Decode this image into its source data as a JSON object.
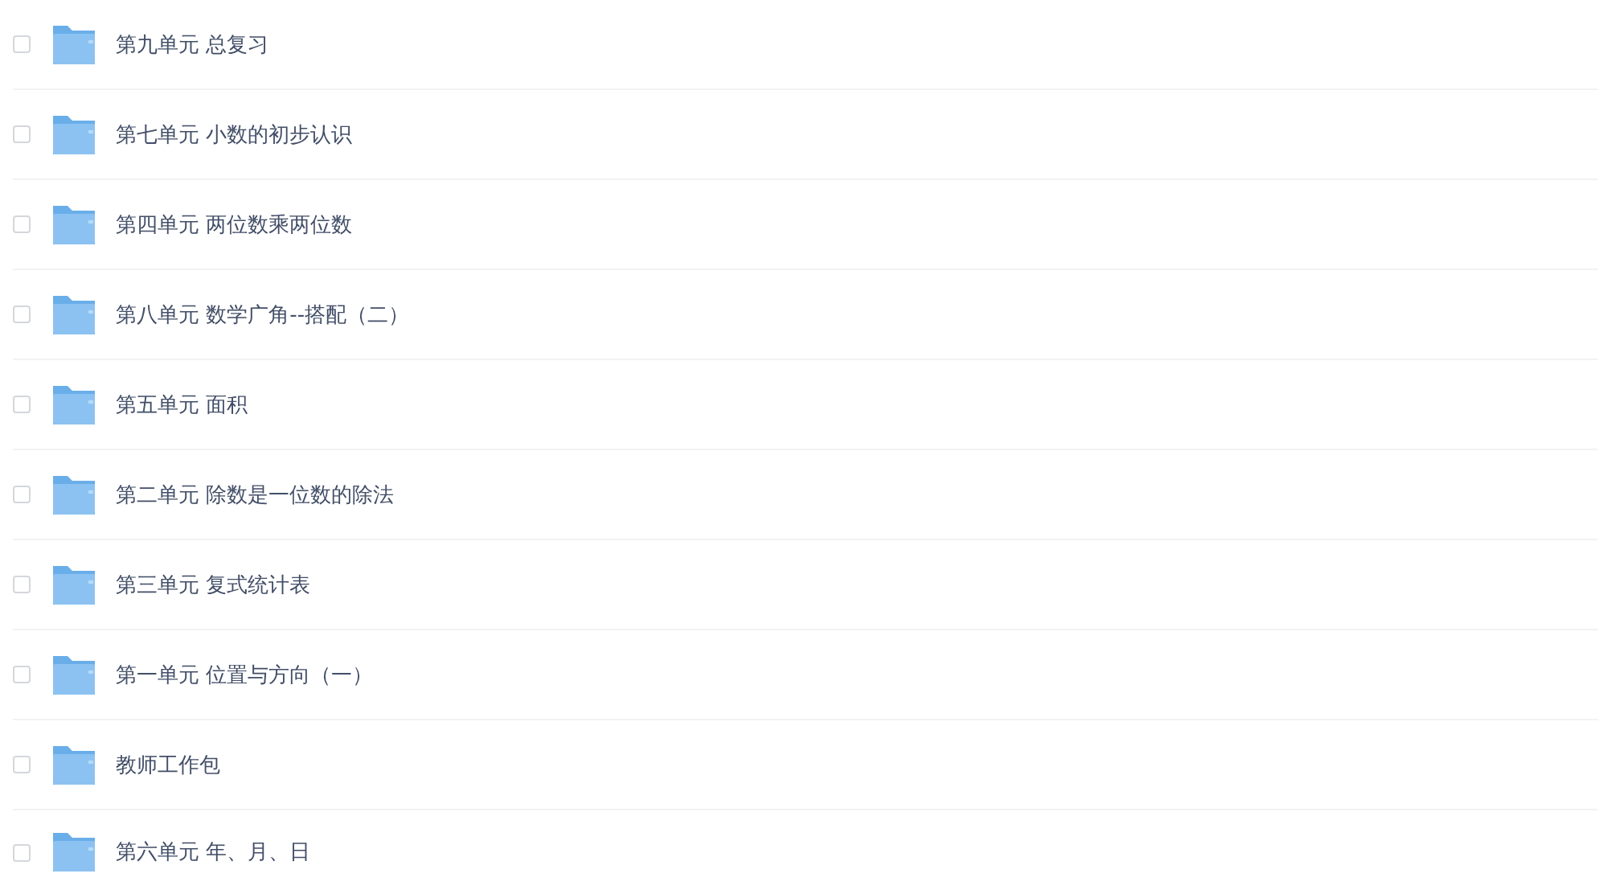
{
  "files": [
    {
      "name": "第九单元 总复习",
      "checked": false
    },
    {
      "name": "第七单元 小数的初步认识",
      "checked": false
    },
    {
      "name": "第四单元 两位数乘两位数",
      "checked": false
    },
    {
      "name": "第八单元 数学广角--搭配（二）",
      "checked": false
    },
    {
      "name": "第五单元 面积",
      "checked": false
    },
    {
      "name": "第二单元 除数是一位数的除法",
      "checked": false
    },
    {
      "name": "第三单元 复式统计表",
      "checked": false
    },
    {
      "name": "第一单元 位置与方向（一）",
      "checked": false
    },
    {
      "name": "教师工作包",
      "checked": false
    },
    {
      "name": "第六单元 年、月、日",
      "checked": false
    }
  ]
}
